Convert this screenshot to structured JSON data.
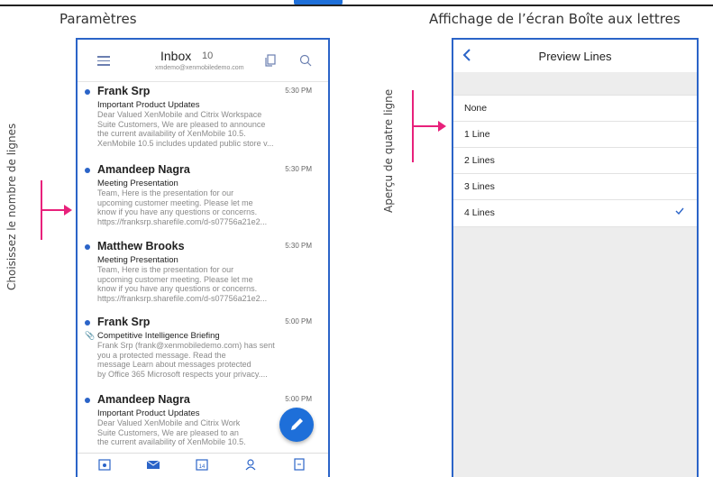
{
  "captions": {
    "left": "Paramètres",
    "right": "Affichage de l’écran Boîte aux lettres"
  },
  "side_labels": {
    "left": "Choisissez le nombre de lignes",
    "right": "Aperçu de quatre ligne"
  },
  "inbox": {
    "title": "Inbox",
    "count": "10",
    "account": "xmdemo@xenmobiledemo.com",
    "messages": [
      {
        "sender": "Frank Srp",
        "time": "5:30 PM",
        "subject": "Important Product Updates",
        "preview": [
          "Dear Valued XenMobile and Citrix Workspace",
          "Suite Customers,    We are pleased to announce",
          "the current availability of XenMobile 10.5.",
          "XenMobile 10.5 includes updated public store v..."
        ]
      },
      {
        "sender": "Amandeep Nagra",
        "time": "5:30 PM",
        "subject": "Meeting Presentation",
        "preview": [
          "Team,    Here is the presentation for our",
          "upcoming customer meeting.  Please let me",
          "know if you have any questions or concerns.",
          "https://franksrp.sharefile.com/d-s07756a21e2..."
        ]
      },
      {
        "sender": "Matthew Brooks",
        "time": "5:30 PM",
        "subject": "Meeting Presentation",
        "preview": [
          "Team,    Here is the presentation for our",
          "upcoming customer meeting.  Please let me",
          "know if you have any questions or concerns.",
          "https://franksrp.sharefile.com/d-s07756a21e2..."
        ]
      },
      {
        "sender": "Frank Srp",
        "time": "5:00 PM",
        "subject": "Competitive Intelligence Briefing",
        "preview": [
          "Frank Srp (frank@xenmobiledemo.com) has sent",
          "you a protected message.      Read the",
          "message      Learn about messages protected",
          "by Office 365  Microsoft respects your privacy...."
        ]
      },
      {
        "sender": "Amandeep Nagra",
        "time": "5:00 PM",
        "subject": "Important Product Updates",
        "preview": [
          "Dear Valued XenMobile and Citrix Work",
          "Suite Customers,    We are pleased to an",
          "the current availability of XenMobile 10.5."
        ]
      }
    ],
    "tabbar_icons": [
      "calendar-star-icon",
      "mail-icon",
      "calendar-14-icon",
      "people-icon",
      "document-icon"
    ],
    "tab_day": "14"
  },
  "preview_lines": {
    "title": "Preview Lines",
    "options": [
      "None",
      "1 Line",
      "2 Lines",
      "3 Lines",
      "4 Lines"
    ],
    "selected_index": 4
  },
  "colors": {
    "accent": "#2b64c8",
    "annotation": "#e8217b",
    "fab": "#1e6fd9"
  }
}
